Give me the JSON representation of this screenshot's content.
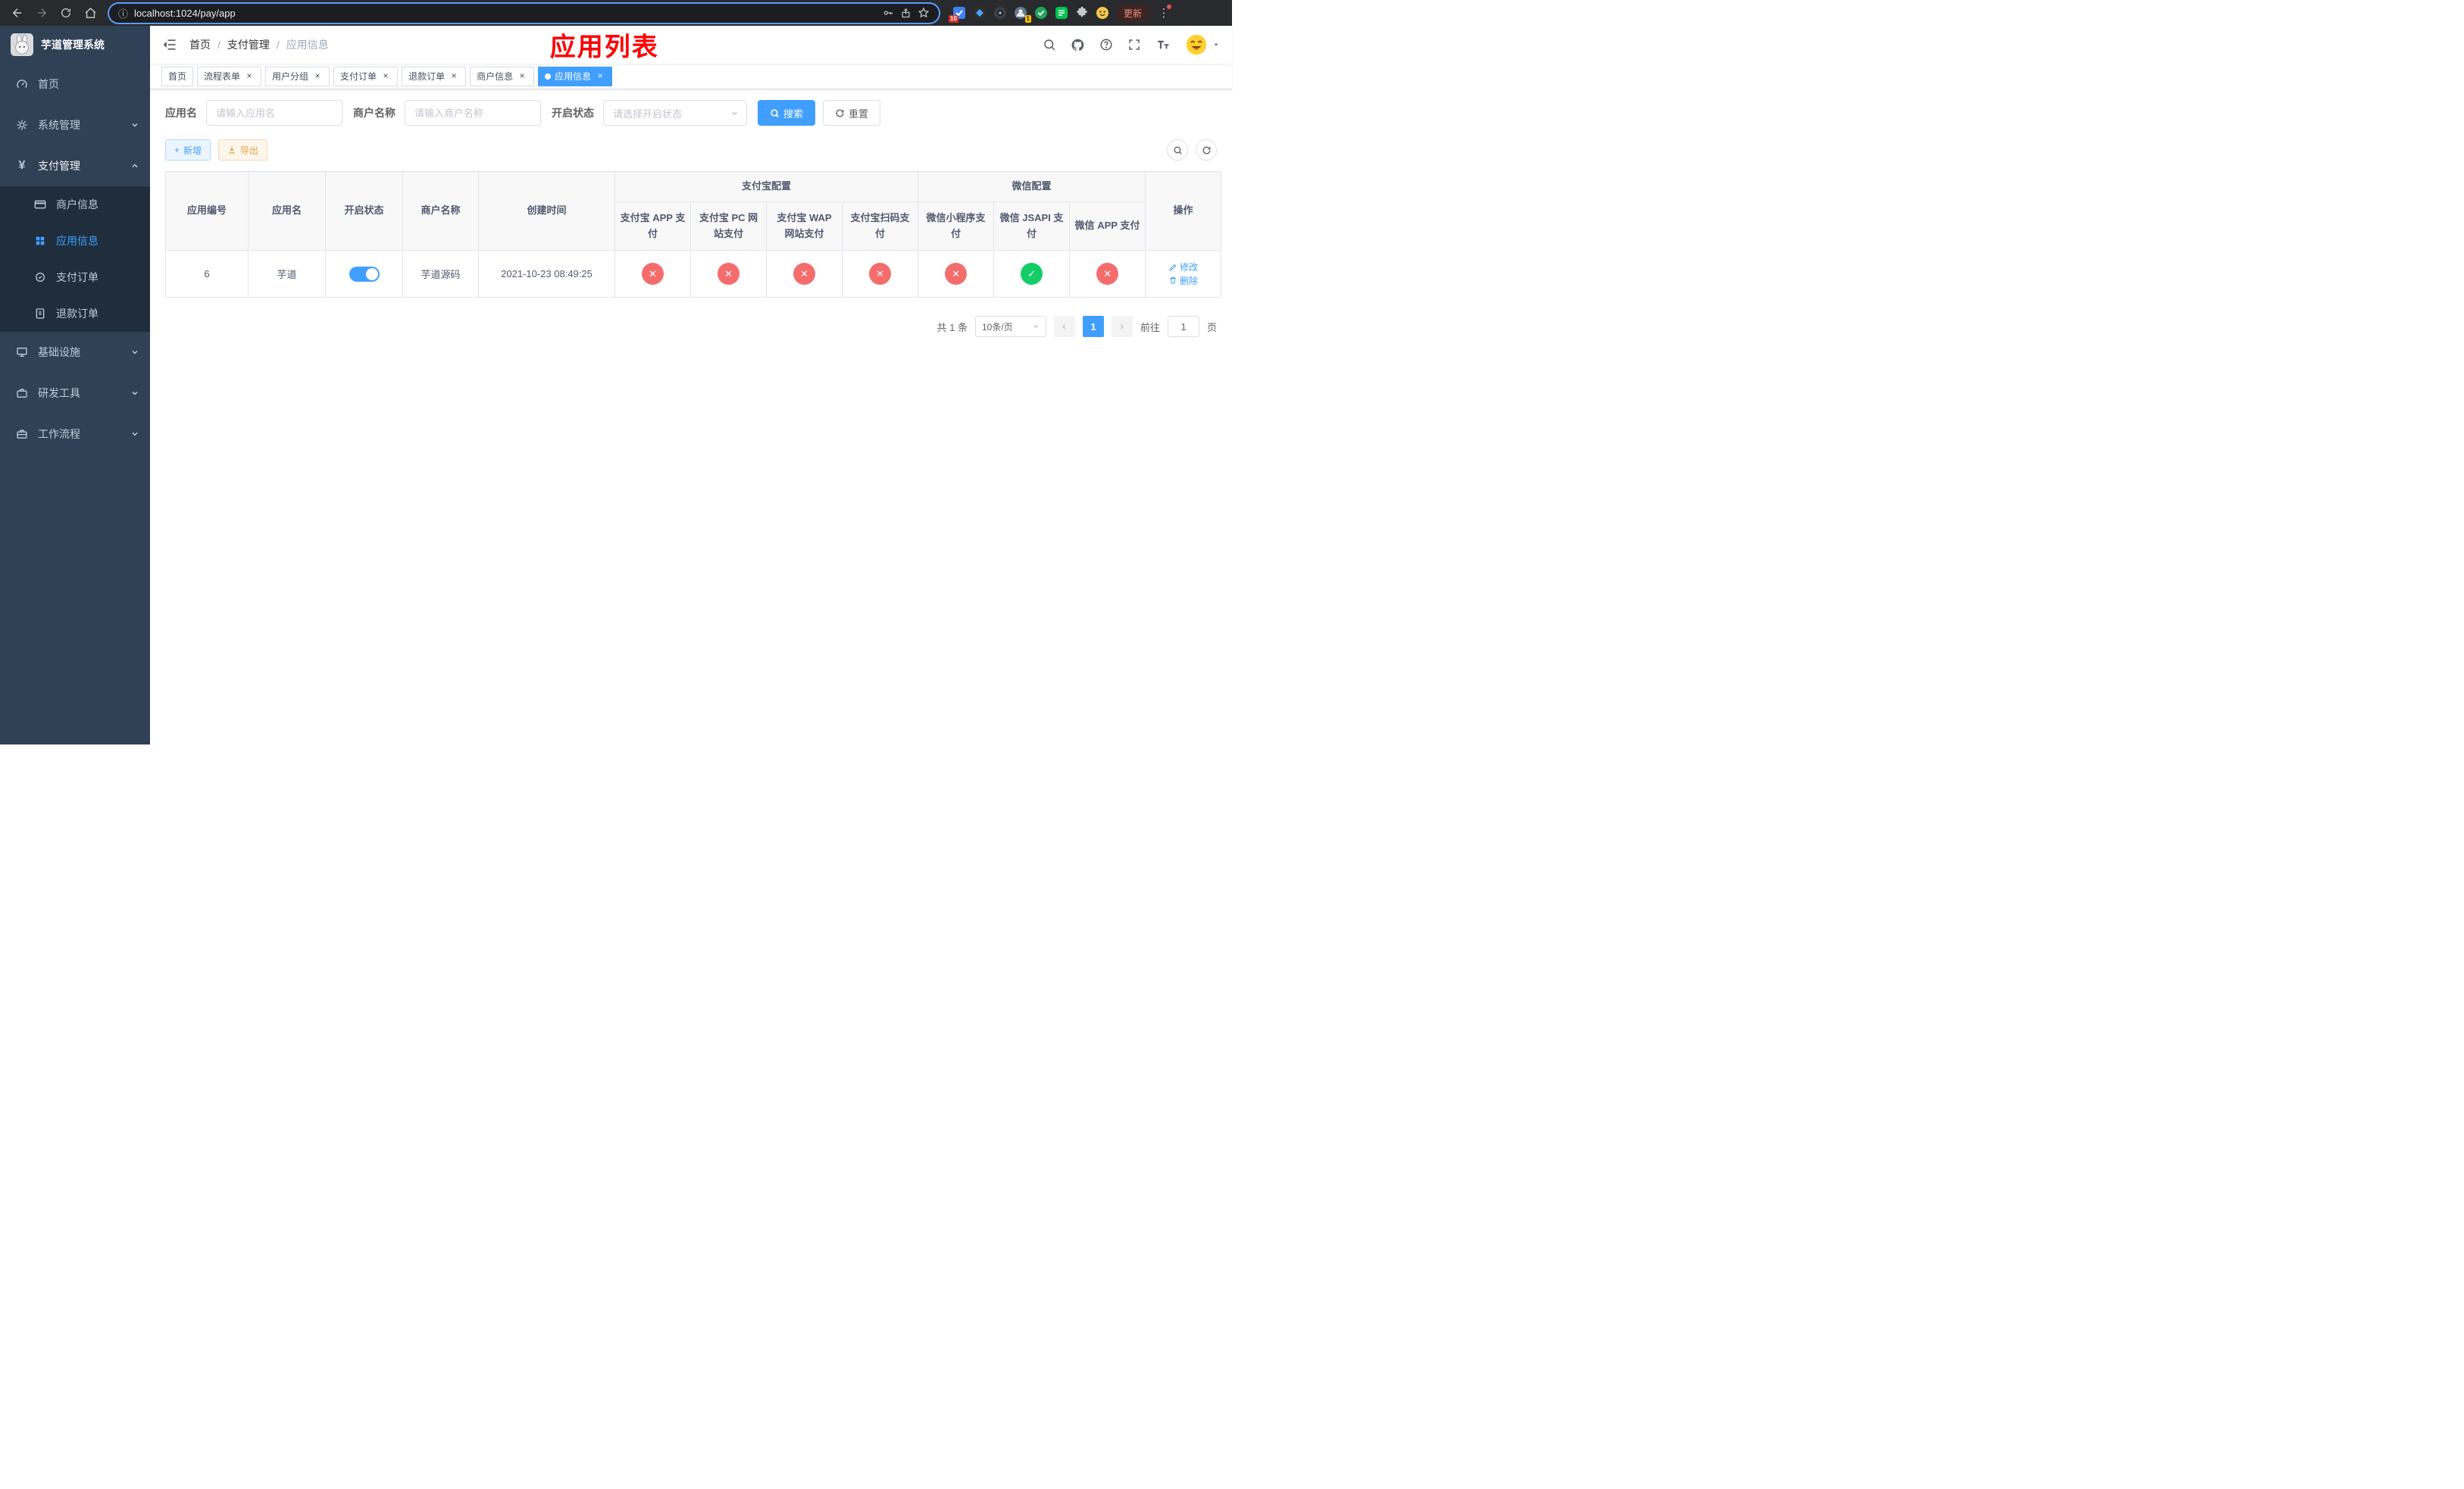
{
  "colors": {
    "accent": "#409eff",
    "success": "#13ce66",
    "danger": "#f56c6c",
    "warning": "#e6a23c",
    "sidebar_bg": "#304156",
    "submenu_bg": "#1f2d3d",
    "annotation_red": "#fe0000"
  },
  "icons": {
    "close": "×",
    "plus": "+",
    "yen": "¥",
    "question": "?",
    "star": "☆",
    "menu_dots": "⋮",
    "info": "ⓘ",
    "check": "✓",
    "cross": "✕"
  },
  "browser": {
    "url": "localhost:1024/pay/app",
    "update_label": "更新",
    "extensions_badge": "10",
    "profile_badge": "1"
  },
  "sidebar": {
    "title": "芋道管理系统",
    "items": [
      {
        "label": "首页"
      },
      {
        "label": "系统管理"
      },
      {
        "label": "支付管理",
        "children": [
          {
            "label": "商户信息"
          },
          {
            "label": "应用信息"
          },
          {
            "label": "支付订单"
          },
          {
            "label": "退款订单"
          }
        ]
      },
      {
        "label": "基础设施"
      },
      {
        "label": "研发工具"
      },
      {
        "label": "工作流程"
      }
    ]
  },
  "header": {
    "breadcrumb": [
      "首页",
      "支付管理",
      "应用信息"
    ],
    "separator": "/",
    "annotation": "应用列表"
  },
  "tabs": [
    {
      "label": "首页"
    },
    {
      "label": "流程表单"
    },
    {
      "label": "用户分组"
    },
    {
      "label": "支付订单"
    },
    {
      "label": "退款订单"
    },
    {
      "label": "商户信息"
    },
    {
      "label": "应用信息"
    }
  ],
  "filters": {
    "app_name_label": "应用名",
    "app_name_placeholder": "请输入应用名",
    "merchant_label": "商户名称",
    "merchant_placeholder": "请输入商户名称",
    "status_label": "开启状态",
    "status_placeholder": "请选择开启状态",
    "search_label": "搜索",
    "reset_label": "重置"
  },
  "toolbar": {
    "add_label": "新增",
    "export_label": "导出"
  },
  "table": {
    "columns": [
      "应用编号",
      "应用名",
      "开启状态",
      "商户名称",
      "创建时间",
      "操作"
    ],
    "alipay_group": "支付宝配置",
    "wechat_group": "微信配置",
    "sub_columns": [
      "支付宝 APP 支付",
      "支付宝 PC 网站支付",
      "支付宝 WAP 网站支付",
      "支付宝扫码支付",
      "微信小程序支付",
      "微信 JSAPI 支付",
      "微信 APP 支付"
    ],
    "edit_label": "修改",
    "delete_label": "删除",
    "rows": [
      {
        "id": "6",
        "name": "芋道",
        "status_on": true,
        "merchant": "芋道源码",
        "created": "2021-10-23 08:49:25",
        "configs": [
          "no",
          "no",
          "no",
          "no",
          "no",
          "yes",
          "no"
        ]
      }
    ]
  },
  "pagination": {
    "total": "共 1 条",
    "page_size": "10条/页",
    "current_page": "1",
    "goto_label": "前往",
    "goto_value": "1",
    "page_suffix": "页"
  }
}
